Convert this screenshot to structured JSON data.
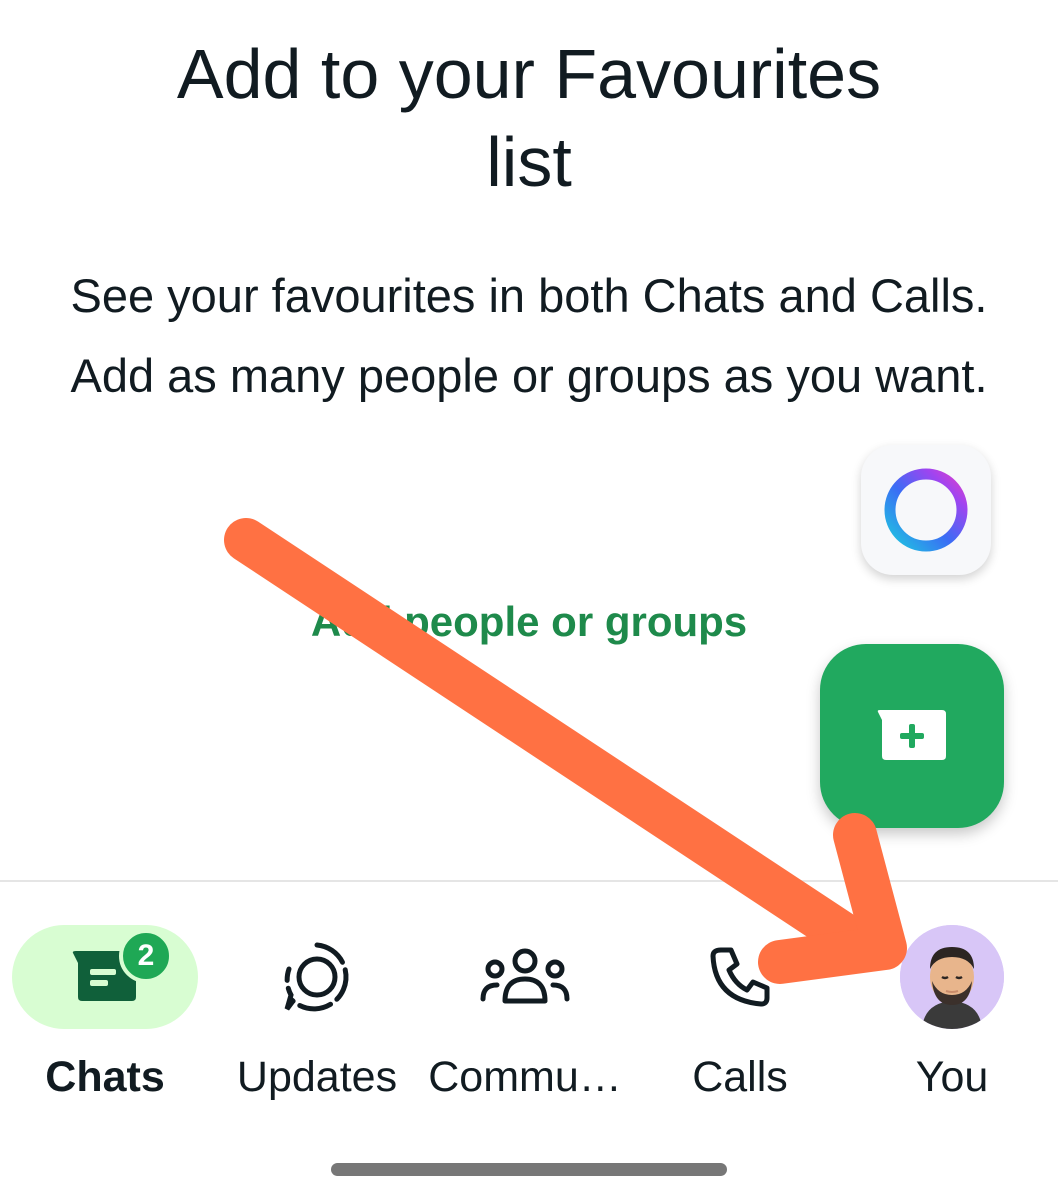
{
  "main": {
    "title_line1": "Add to your Favourites",
    "title_line2": "list",
    "description": "See your favourites in both Chats and Calls. Add as many people or groups as you want.",
    "add_link": "Add people or groups"
  },
  "floating_buttons": {
    "meta_ai_icon": "meta-ai-ring-icon",
    "new_chat_icon": "new-chat-plus-icon"
  },
  "bottom_nav": {
    "items": [
      {
        "label": "Chats",
        "icon": "chat-icon",
        "badge": "2",
        "active": true
      },
      {
        "label": "Updates",
        "icon": "updates-status-icon",
        "active": false
      },
      {
        "label": "Commu…",
        "icon": "communities-icon",
        "active": false
      },
      {
        "label": "Calls",
        "icon": "phone-icon",
        "active": false
      },
      {
        "label": "You",
        "icon": "avatar",
        "active": false
      }
    ]
  },
  "annotation": {
    "type": "arrow",
    "color": "#ff7143"
  },
  "colors": {
    "accent_green": "#21a95f",
    "link_green": "#1e8a4b",
    "active_pill": "#d8fdd2",
    "badge_green": "#1fa855",
    "avatar_bg": "#d8c6f7"
  }
}
